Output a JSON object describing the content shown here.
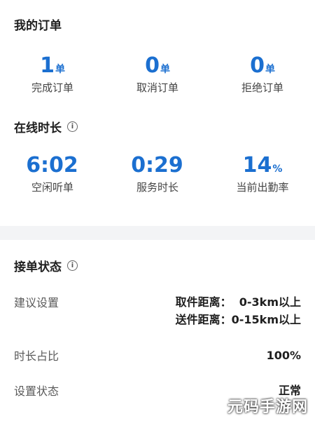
{
  "orders": {
    "title": "我的订单",
    "stats": [
      {
        "value": "1",
        "unit": "单",
        "label": "完成订单"
      },
      {
        "value": "0",
        "unit": "单",
        "label": "取消订单"
      },
      {
        "value": "0",
        "unit": "单",
        "label": "拒绝订单"
      }
    ]
  },
  "online": {
    "title": "在线时长",
    "info_icon": "i",
    "stats": [
      {
        "value": "6:02",
        "unit": "",
        "label": "空闲听单"
      },
      {
        "value": "0:29",
        "unit": "",
        "label": "服务时长"
      },
      {
        "value": "14",
        "unit": "%",
        "label": "当前出勤率"
      }
    ]
  },
  "accept": {
    "title": "接单状态",
    "info_icon": "i",
    "rows": {
      "suggested_label": "建议设置",
      "pickup_value": "取件距离：  0-3km以上",
      "delivery_value": "送件距离：0-15km以上",
      "ratio_label": "时长占比",
      "ratio_value": "100%",
      "status_label": "设置状态",
      "status_value": "正常"
    }
  },
  "watermark": "元码手游网",
  "colors": {
    "accent": "#1b6fd0",
    "divider": "#f3f4f6"
  }
}
